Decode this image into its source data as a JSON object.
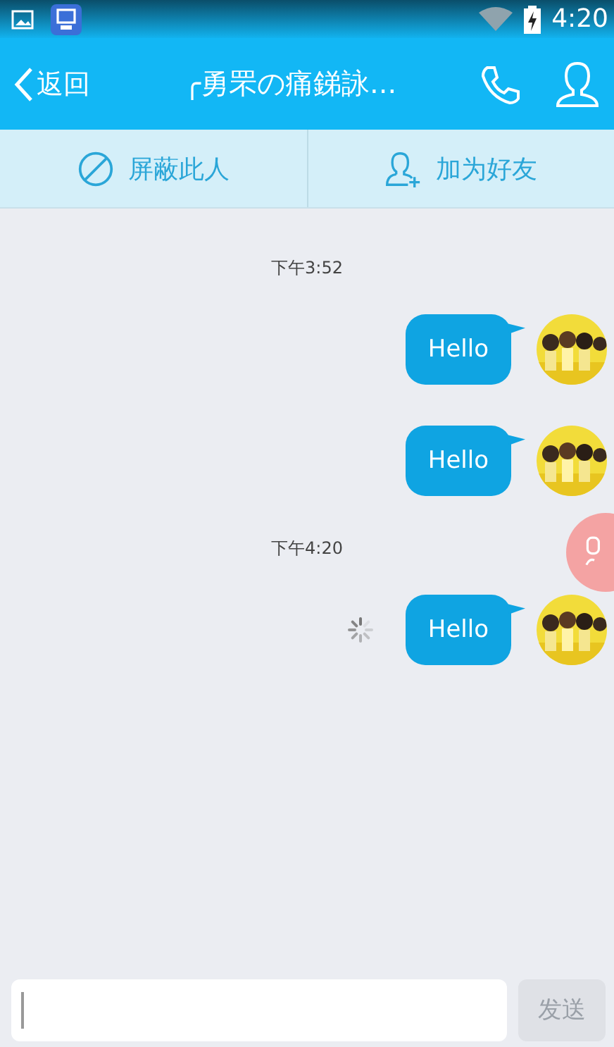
{
  "status_bar": {
    "time": "4:20"
  },
  "header": {
    "back": "返回",
    "title": "╭勇罘の痛銻詠..."
  },
  "actions": [
    {
      "label": "屏蔽此人",
      "kind": "block"
    },
    {
      "label": "加为好友",
      "kind": "add"
    }
  ],
  "messages": [
    {
      "kind": "time",
      "text": "下午3:52"
    },
    {
      "kind": "message",
      "text": "Hello",
      "sending": false
    },
    {
      "kind": "message",
      "text": "Hello",
      "sending": false
    },
    {
      "kind": "time",
      "text": "下午4:20"
    },
    {
      "kind": "message",
      "text": "Hello",
      "sending": true
    }
  ],
  "composer": {
    "send": "发送",
    "disabled": true
  }
}
